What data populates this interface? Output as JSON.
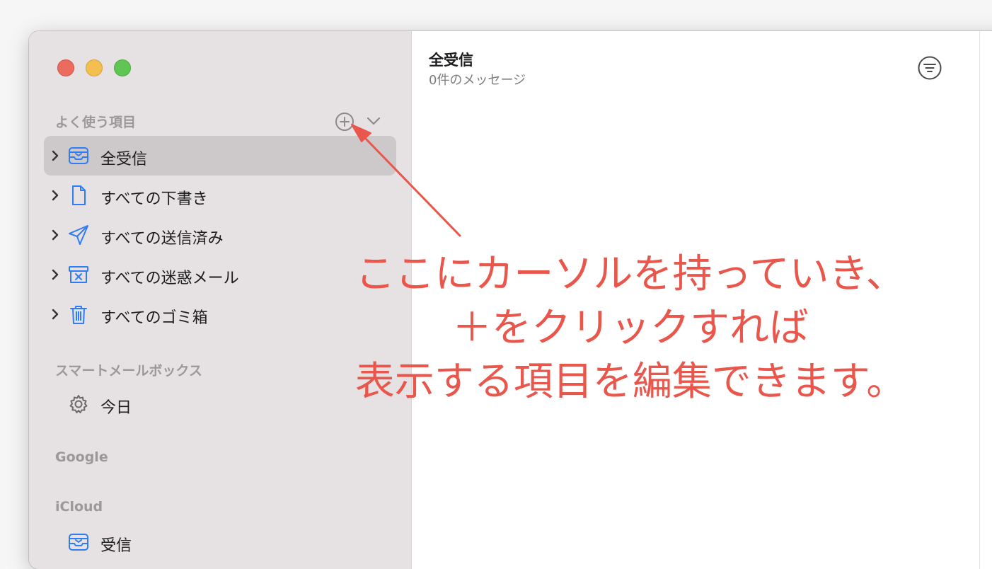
{
  "sidebar": {
    "favorites_header": "よく使う項目",
    "favorites": [
      {
        "label": "全受信",
        "icon": "tray-icon",
        "selected": true
      },
      {
        "label": "すべての下書き",
        "icon": "document-icon",
        "selected": false
      },
      {
        "label": "すべての送信済み",
        "icon": "paper-plane-icon",
        "selected": false
      },
      {
        "label": "すべての迷惑メール",
        "icon": "junk-icon",
        "selected": false
      },
      {
        "label": "すべてのゴミ箱",
        "icon": "trash-icon",
        "selected": false
      }
    ],
    "smart_header": "スマートメールボックス",
    "smart_items": [
      {
        "label": "今日",
        "icon": "gear-icon"
      }
    ],
    "google_header": "Google",
    "icloud_header": "iCloud",
    "icloud_items": [
      {
        "label": "受信",
        "icon": "tray-icon"
      }
    ]
  },
  "content": {
    "title": "全受信",
    "subtitle": "0件のメッセージ"
  },
  "annotation": {
    "lines": [
      "ここにカーソルを持っていき、",
      "＋をクリックすれば",
      "表示する項目を編集できます。"
    ]
  },
  "colors": {
    "accent_icon": "#2f7cf6",
    "annotation": "#e9564b",
    "sidebar_bg": "#e6e1e2",
    "selected_row": "#cdc8ca"
  }
}
